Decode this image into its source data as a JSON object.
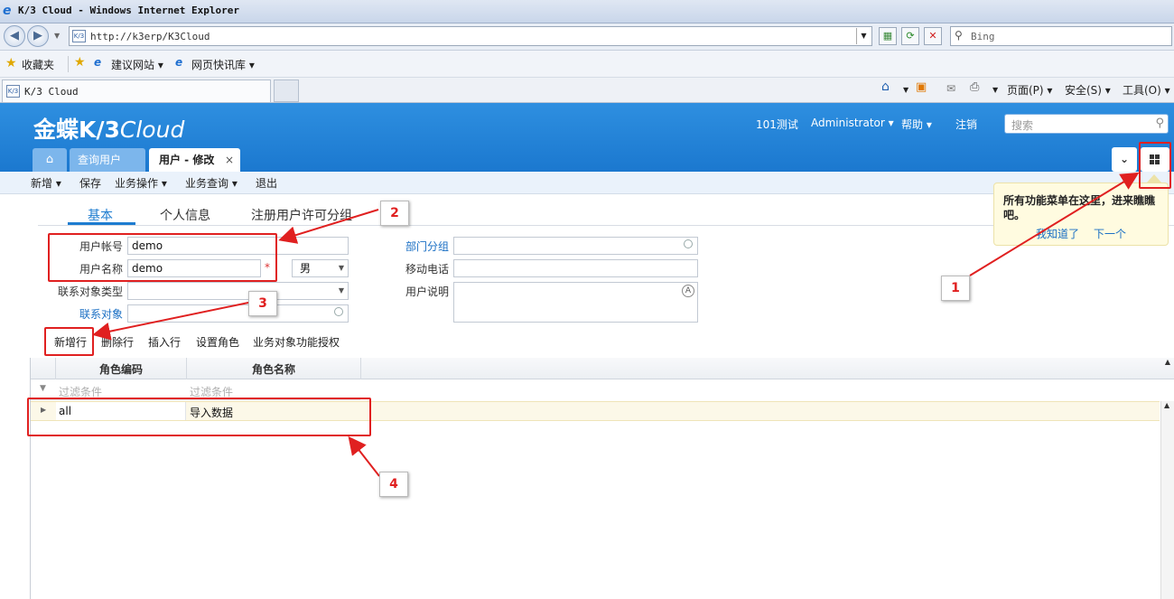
{
  "browser": {
    "title": "K/3 Cloud - Windows Internet Explorer",
    "url": "http://k3erp/K3Cloud",
    "search_placeholder": "Bing",
    "favorites": [
      "收藏夹",
      "建议网站 ▾",
      "网页快讯库 ▾"
    ],
    "tab_title": "K/3 Cloud",
    "commands": [
      "页面(P) ▾",
      "安全(S) ▾",
      "工具(O) ▾"
    ]
  },
  "header": {
    "logo_main": "金蝶K/3",
    "logo_sub": "Cloud",
    "links": [
      "101测试",
      "Administrator ▾",
      "帮助 ▾",
      "注销"
    ],
    "search_placeholder": "搜索"
  },
  "tabs": {
    "query": "查询用户",
    "edit": "用户 - 修改",
    "close": "×"
  },
  "toolbar": [
    "新增 ▾",
    "保存",
    "业务操作 ▾",
    "业务查询 ▾",
    "退出"
  ],
  "subtabs": [
    "基本",
    "个人信息",
    "注册用户许可分组"
  ],
  "form": {
    "account_label": "用户帐号",
    "account_value": "demo",
    "name_label": "用户名称",
    "name_value": "demo",
    "gender": "男",
    "contact_type_label": "联系对象类型",
    "contact_label": "联系对象",
    "dept_label": "部门分组",
    "mobile_label": "移动电话",
    "desc_label": "用户说明"
  },
  "entry_toolbar": [
    "新增行",
    "删除行",
    "插入行",
    "设置角色",
    "业务对象功能授权"
  ],
  "grid": {
    "columns": [
      "角色编码",
      "角色名称"
    ],
    "filter_placeholder": "过滤条件",
    "rows": [
      {
        "code": "all",
        "name": "导入数据"
      }
    ]
  },
  "tooltip": {
    "message": "所有功能菜单在这里，进来瞧瞧吧。",
    "got_it": "我知道了",
    "next": "下一个"
  },
  "annotations": [
    "1",
    "2",
    "3",
    "4"
  ],
  "colors": {
    "header_blue": "#1f7fd6",
    "annotation_red": "#e02020",
    "link_blue": "#1a6fc4",
    "tooltip_bg": "#fffbe0"
  }
}
